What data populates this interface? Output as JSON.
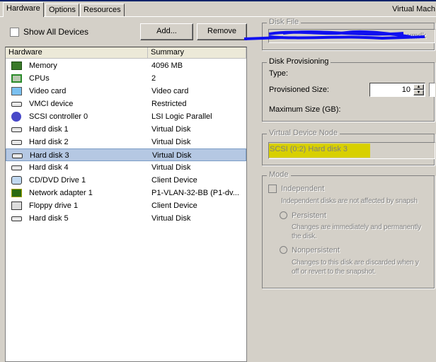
{
  "tabs": [
    "Hardware",
    "Options",
    "Resources"
  ],
  "window_title": "Virtual Mach",
  "show_all_devices": {
    "label": "Show All Devices",
    "checked": false
  },
  "buttons": {
    "add": "Add...",
    "remove": "Remove"
  },
  "columns": [
    "Hardware",
    "Summary"
  ],
  "devices": [
    {
      "name": "Memory",
      "summary": "4096 MB",
      "icon": "memory-icon"
    },
    {
      "name": "CPUs",
      "summary": "2",
      "icon": "cpu-icon"
    },
    {
      "name": "Video card",
      "summary": "Video card",
      "icon": "monitor-icon"
    },
    {
      "name": "VMCI device",
      "summary": "Restricted",
      "icon": "device-icon"
    },
    {
      "name": "SCSI controller 0",
      "summary": "LSI Logic Parallel",
      "icon": "scsi-controller-icon"
    },
    {
      "name": "Hard disk 1",
      "summary": "Virtual Disk",
      "icon": "hard-disk-icon"
    },
    {
      "name": "Hard disk 2",
      "summary": "Virtual Disk",
      "icon": "hard-disk-icon"
    },
    {
      "name": "Hard disk 3",
      "summary": "Virtual Disk",
      "icon": "hard-disk-icon",
      "selected": true
    },
    {
      "name": "Hard disk 4",
      "summary": "Virtual Disk",
      "icon": "hard-disk-icon"
    },
    {
      "name": "CD/DVD Drive 1",
      "summary": "Client Device",
      "icon": "cd-dvd-icon"
    },
    {
      "name": "Network adapter 1",
      "summary": "P1-VLAN-32-BB (P1-dv...",
      "icon": "network-adapter-icon"
    },
    {
      "name": "Floppy drive 1",
      "summary": "Client Device",
      "icon": "floppy-icon"
    },
    {
      "name": "Hard disk 5",
      "summary": "Virtual Disk",
      "icon": "hard-disk-icon"
    }
  ],
  "disk_file": {
    "title": "Disk File",
    "value_suffix": "vmdk"
  },
  "provisioning": {
    "title": "Disk Provisioning",
    "type_label": "Type:",
    "size_label": "Provisioned Size:",
    "size_value": "10",
    "max_label": "Maximum Size (GB):"
  },
  "node": {
    "title": "Virtual Device Node",
    "value": "SCSI (0:2) Hard disk 3",
    "highlight": "#d8d000"
  },
  "mode": {
    "title": "Mode",
    "independent": "Independent",
    "independent_desc": "Independent disks are not affected by snapsh",
    "persistent": "Persistent",
    "persistent_desc1": "Changes are immediately and permanently",
    "persistent_desc2": "the disk.",
    "nonpersistent": "Nonpersistent",
    "nonpersistent_desc1": "Changes to this disk are discarded when y",
    "nonpersistent_desc2": "off or revert to the snapshot."
  }
}
